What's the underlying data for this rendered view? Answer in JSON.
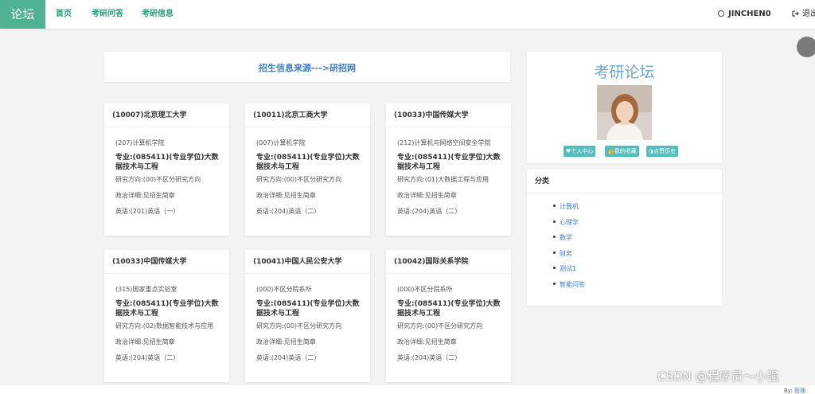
{
  "nav": {
    "brand": "论坛",
    "links": [
      "首页",
      "考研问答",
      "考研信息"
    ],
    "user": "JINCHEN0",
    "logout": "退出"
  },
  "source": {
    "label": "招生信息来源--->研招网"
  },
  "cards": [
    {
      "school": "(10007)北京理工大学",
      "college": "(207)计算机学院",
      "major": "专业:(085411)(专业学位)大数据技术与工程",
      "direction": "研究方向:(00)不区分研究方向",
      "politics": "政治详细:见招生简章",
      "english": "英语:(201)英语（一）"
    },
    {
      "school": "(10011)北京工商大学",
      "college": "(007)计算机学院",
      "major": "专业:(085411)(专业学位)大数据技术与工程",
      "direction": "研究方向:(00)不区分研究方向",
      "politics": "政治详细:见招生简章",
      "english": "英语:(204)英语（二）"
    },
    {
      "school": "(10033)中国传媒大学",
      "college": "(212)计算机与网络空间安全学院",
      "major": "专业:(085411)(专业学位)大数据技术与工程",
      "direction": "研究方向:(01)大数据工程与应用",
      "politics": "政治详细:见招生简章",
      "english": "英语:(204)英语（二）"
    },
    {
      "school": "(10033)中国传媒大学",
      "college": "(315)国家重点实验室",
      "major": "专业:(085411)(专业学位)大数据技术与工程",
      "direction": "研究方向:(02)数据智能技术与应用",
      "politics": "政治详细:见招生简章",
      "english": "英语:(204)英语（二）"
    },
    {
      "school": "(10041)中国人民公安大学",
      "college": "(000)不区分院系所",
      "major": "专业:(085411)(专业学位)大数据技术与工程",
      "direction": "研究方向:(00)不区分研究方向",
      "politics": "政治详细:见招生简章",
      "english": "英语:(204)英语（二）"
    },
    {
      "school": "(10042)国际关系学院",
      "college": "(000)不区分院系所",
      "major": "专业:(085411)(专业学位)大数据技术与工程",
      "direction": "研究方向:(00)不区分研究方向",
      "politics": "政治详细:见招生简章",
      "english": "英语:(204)英语（二）"
    }
  ],
  "profile": {
    "title": "考研论坛",
    "buttons": [
      "♥个人中心",
      "👍我的收藏",
      "◑点赞历史"
    ]
  },
  "categories": {
    "title": "分类",
    "items": [
      "计算机",
      "心理学",
      "数学",
      "财务",
      "测试1",
      "智能问答"
    ]
  },
  "watermark": "CSDN @程序员～小强",
  "footer": {
    "by": "By:",
    "link": "管理"
  },
  "colors": {
    "brand": "#4fb294",
    "nav_link": "#2e9b7b",
    "link": "#3f7cc4",
    "accent_button": "#53bdbd",
    "forum_title": "#6aa6d0"
  },
  "icons": {
    "user": "user-circle-icon",
    "logout": "logout-icon",
    "float": "float-circle-icon"
  }
}
